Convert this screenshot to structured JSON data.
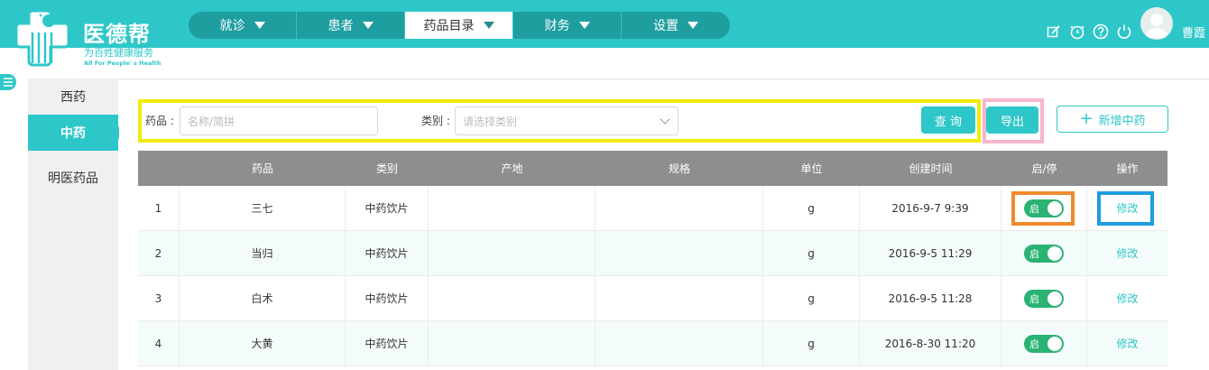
{
  "brand": {
    "title": "医德帮",
    "subtitle": "为百姓健康服务",
    "english": "All For People' s Health",
    "color": "#2ec7c9"
  },
  "nav": {
    "items": [
      {
        "label": "就诊"
      },
      {
        "label": "患者"
      },
      {
        "label": "药品目录",
        "active": true
      },
      {
        "label": "财务"
      },
      {
        "label": "设置"
      }
    ]
  },
  "header": {
    "icons": [
      "edit-icon",
      "bell-icon",
      "help-icon",
      "power-icon"
    ],
    "user_name": "曹霞"
  },
  "sidebar": {
    "items": [
      {
        "label": "西药"
      },
      {
        "label": "中药",
        "active": true
      },
      {
        "label": "明医药品"
      }
    ]
  },
  "filter": {
    "drug_label": "药品 :",
    "drug_placeholder": "名称/简拼",
    "category_label": "类别 :",
    "category_placeholder": "请选择类别",
    "query_button": "查 询",
    "export_button": "导出",
    "add_button": "新增中药"
  },
  "table": {
    "headers": [
      "",
      "药品",
      "类别",
      "产地",
      "规格",
      "单位",
      "创建时间",
      "启/停",
      "操作"
    ],
    "rows": [
      {
        "index": "1",
        "name": "三七",
        "category": "中药饮片",
        "origin": "",
        "spec": "",
        "unit": "g",
        "created": "2016-9-7 9:39",
        "status": "启",
        "action": "修改"
      },
      {
        "index": "2",
        "name": "当归",
        "category": "中药饮片",
        "origin": "",
        "spec": "",
        "unit": "g",
        "created": "2016-9-5 11:29",
        "status": "启",
        "action": "修改"
      },
      {
        "index": "3",
        "name": "白术",
        "category": "中药饮片",
        "origin": "",
        "spec": "",
        "unit": "g",
        "created": "2016-9-5 11:28",
        "status": "启",
        "action": "修改"
      },
      {
        "index": "4",
        "name": "大黄",
        "category": "中药饮片",
        "origin": "",
        "spec": "",
        "unit": "g",
        "created": "2016-8-30 11:20",
        "status": "启",
        "action": "修改"
      }
    ]
  }
}
